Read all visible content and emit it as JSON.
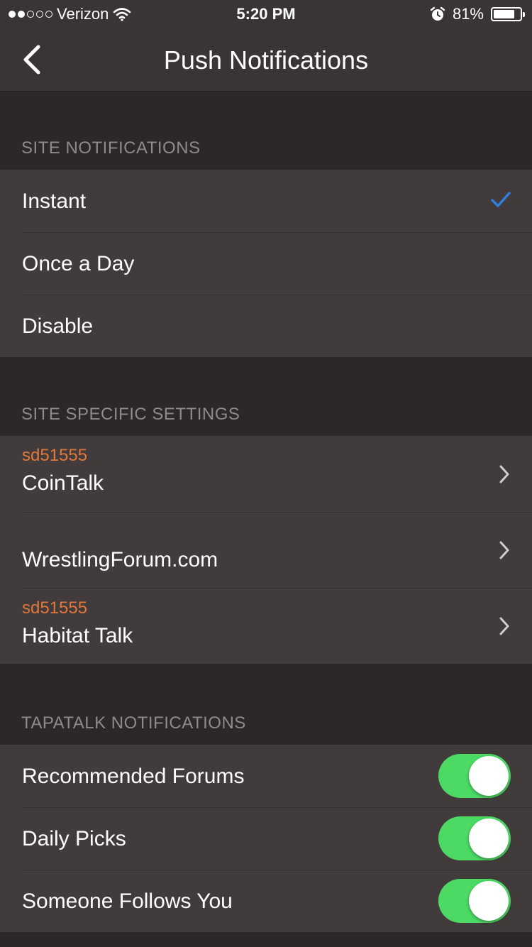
{
  "status_bar": {
    "carrier": "Verizon",
    "signal_dots_filled": 2,
    "signal_dots_total": 5,
    "time": "5:20 PM",
    "battery": "81%",
    "battery_level": 0.81
  },
  "nav": {
    "title": "Push Notifications",
    "back_icon": "chevron-left-icon"
  },
  "colors": {
    "accent_check": "#2f7fdc",
    "username": "#e3763a",
    "toggle_on": "#4cd964"
  },
  "site_notifications": {
    "header": "SITE NOTIFICATIONS",
    "options": [
      {
        "label": "Instant",
        "selected": true
      },
      {
        "label": "Once a Day",
        "selected": false
      },
      {
        "label": "Disable",
        "selected": false
      }
    ]
  },
  "site_specific": {
    "header": "SITE SPECIFIC SETTINGS",
    "items": [
      {
        "username": "sd51555",
        "name": "CoinTalk"
      },
      {
        "username": "",
        "name": "WrestlingForum.com"
      },
      {
        "username": "sd51555",
        "name": "Habitat Talk"
      }
    ]
  },
  "tapatalk": {
    "header": "TAPATALK NOTIFICATIONS",
    "items": [
      {
        "label": "Recommended Forums",
        "on": true
      },
      {
        "label": "Daily Picks",
        "on": true
      },
      {
        "label": "Someone Follows You",
        "on": true
      }
    ]
  }
}
